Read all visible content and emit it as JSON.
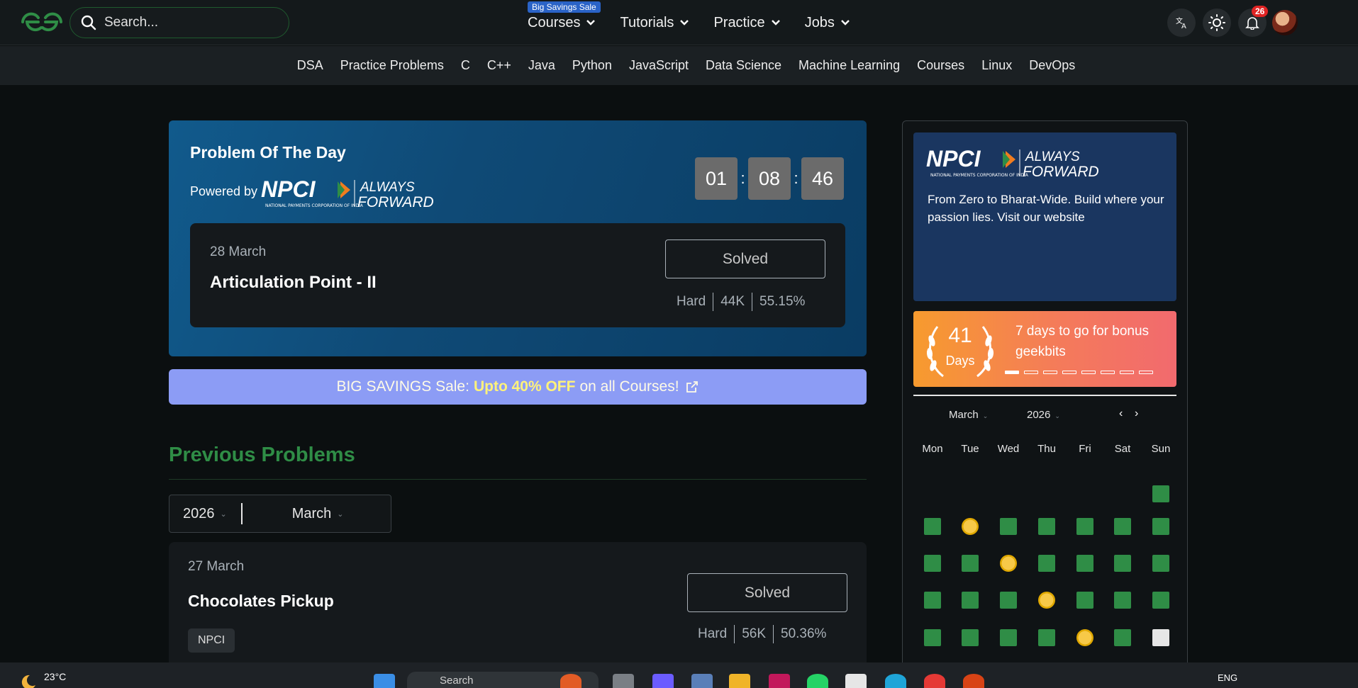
{
  "header": {
    "search_placeholder": "Search...",
    "sale_badge": "Big Savings Sale",
    "nav": [
      {
        "label": "Courses"
      },
      {
        "label": "Tutorials"
      },
      {
        "label": "Practice"
      },
      {
        "label": "Jobs"
      }
    ],
    "notification_count": "26"
  },
  "subnav": [
    "DSA",
    "Practice Problems",
    "C",
    "C++",
    "Java",
    "Python",
    "JavaScript",
    "Data Science",
    "Machine Learning",
    "Courses",
    "Linux",
    "DevOps"
  ],
  "potd": {
    "title": "Problem Of The Day",
    "powered_by": "Powered by",
    "timer": {
      "hours": "01",
      "minutes": "08",
      "seconds": "46"
    },
    "problem": {
      "date": "28 March",
      "name": "Articulation Point - II",
      "status": "Solved",
      "difficulty": "Hard",
      "submissions": "44K",
      "accuracy": "55.15%"
    }
  },
  "sale_banner": {
    "prefix": "BIG SAVINGS Sale:",
    "highlight": "Upto 40% OFF",
    "suffix": "on all Courses!"
  },
  "previous": {
    "title": "Previous Problems",
    "year": "2026",
    "month": "March",
    "problem": {
      "date": "27 March",
      "name": "Chocolates Pickup",
      "tag": "NPCI",
      "status": "Solved",
      "difficulty": "Hard",
      "submissions": "56K",
      "accuracy": "50.36%"
    }
  },
  "sidebar": {
    "ad_text": "From Zero to Bharat-Wide. Build where your passion lies. Visit our website",
    "streak": {
      "count": "41",
      "unit": "Days",
      "message": "7 days to go for bonus geekbits",
      "progress_filled": 1,
      "progress_total": 8
    },
    "calendar": {
      "month": "March",
      "year": "2026",
      "prev": "‹",
      "next": "›",
      "weekdays": [
        "Mon",
        "Tue",
        "Wed",
        "Thu",
        "Fri",
        "Sat",
        "Sun"
      ]
    }
  },
  "taskbar": {
    "temperature": "23°C",
    "search": "Search",
    "language": "ENG"
  },
  "colors": {
    "brand_green": "#2f8d46",
    "potd_blue": "#115a8c",
    "sale_purple": "#8c9cf5",
    "streak_orange": "#f79b2e"
  },
  "icons": {
    "logo": "gfg-logo",
    "search": "search-icon",
    "translate": "translate-icon",
    "theme": "sun-icon",
    "notifications": "bell-icon",
    "external": "external-link-icon"
  }
}
